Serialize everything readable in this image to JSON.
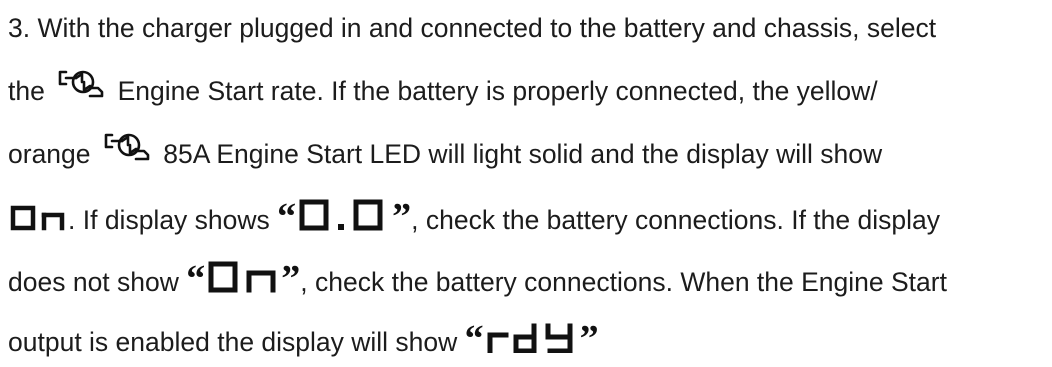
{
  "paragraph": {
    "line1": "3. With the charger plugged in and connected to the battery and chassis, select",
    "line2_a": "the",
    "line2_b": "Engine Start rate. If the battery is properly connected, the yellow/",
    "line3_a": "orange",
    "line3_b": "85A Engine Start LED will light solid and the display will show",
    "line4_a": ". If display shows",
    "line4_b": ", check the battery connections. If the display",
    "line5_a": "does not show",
    "line5_b": ", check the battery connections. When the Engine Start",
    "line6_a": "output is enabled the display will show"
  },
  "display_readouts": {
    "on": "On",
    "zero": "0.0",
    "ready": "rdy"
  },
  "quotes": {
    "open": "“",
    "close": "”"
  },
  "icons": [
    "engine-start-icon",
    "engine-start-icon"
  ]
}
